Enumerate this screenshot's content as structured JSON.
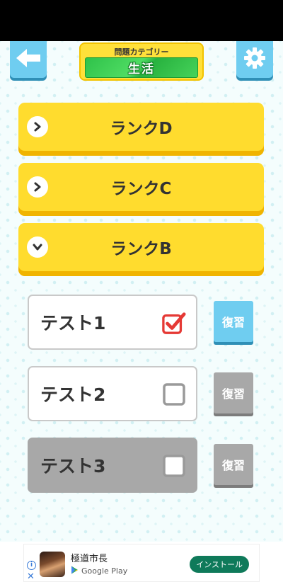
{
  "header": {
    "category_caption": "問題カテゴリー",
    "category_name": "生活",
    "back_icon": "arrow-left-icon",
    "settings_icon": "gear-icon"
  },
  "ranks": [
    {
      "label": "ランクD",
      "expanded": false
    },
    {
      "label": "ランクC",
      "expanded": false
    },
    {
      "label": "ランクB",
      "expanded": true
    }
  ],
  "tests": [
    {
      "label": "テスト1",
      "checked": true,
      "review_label": "復習",
      "review_enabled": true,
      "locked": false
    },
    {
      "label": "テスト2",
      "checked": false,
      "review_label": "復習",
      "review_enabled": false,
      "locked": false
    },
    {
      "label": "テスト3",
      "checked": false,
      "review_label": "復習",
      "review_enabled": false,
      "locked": true
    }
  ],
  "ad": {
    "title": "極道市長",
    "store": "Google Play",
    "install_label": "インストール"
  },
  "colors": {
    "accent_blue": "#6fcdf0",
    "rank_yellow": "#ffdc2e",
    "category_green": "#2fc24a",
    "check_red": "#e53935",
    "disabled_gray": "#a8a8a8"
  }
}
